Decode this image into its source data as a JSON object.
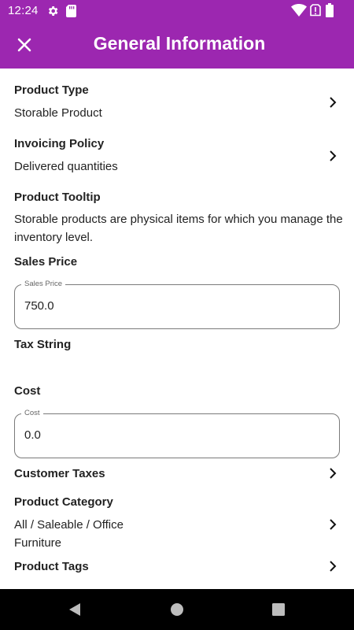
{
  "status_bar": {
    "time": "12:24",
    "icons": [
      "settings-icon",
      "sd-card-icon",
      "wifi-icon",
      "no-sim-icon",
      "battery-icon"
    ]
  },
  "app_bar": {
    "title": "General Information",
    "close_icon": "close-icon",
    "color": "#9c27b0"
  },
  "product_type": {
    "label": "Product Type",
    "value": "Storable Product"
  },
  "invoicing_policy": {
    "label": "Invoicing Policy",
    "value": "Delivered quantities"
  },
  "product_tooltip": {
    "label": "Product Tooltip",
    "text": "Storable products are physical items for which you manage the inventory level."
  },
  "sales_price": {
    "label": "Sales Price",
    "field_label": "Sales Price",
    "value": "750.0"
  },
  "tax_string": {
    "label": "Tax String"
  },
  "cost": {
    "label": "Cost",
    "field_label": "Cost",
    "value": "0.0"
  },
  "customer_taxes": {
    "label": "Customer Taxes"
  },
  "product_category": {
    "label": "Product Category",
    "value_line1": "All / Saleable / Office",
    "value_line2": "Furniture"
  },
  "product_tags": {
    "label": "Product Tags"
  },
  "nav_bar": {
    "buttons": [
      "back-icon",
      "home-icon",
      "recents-icon"
    ]
  }
}
